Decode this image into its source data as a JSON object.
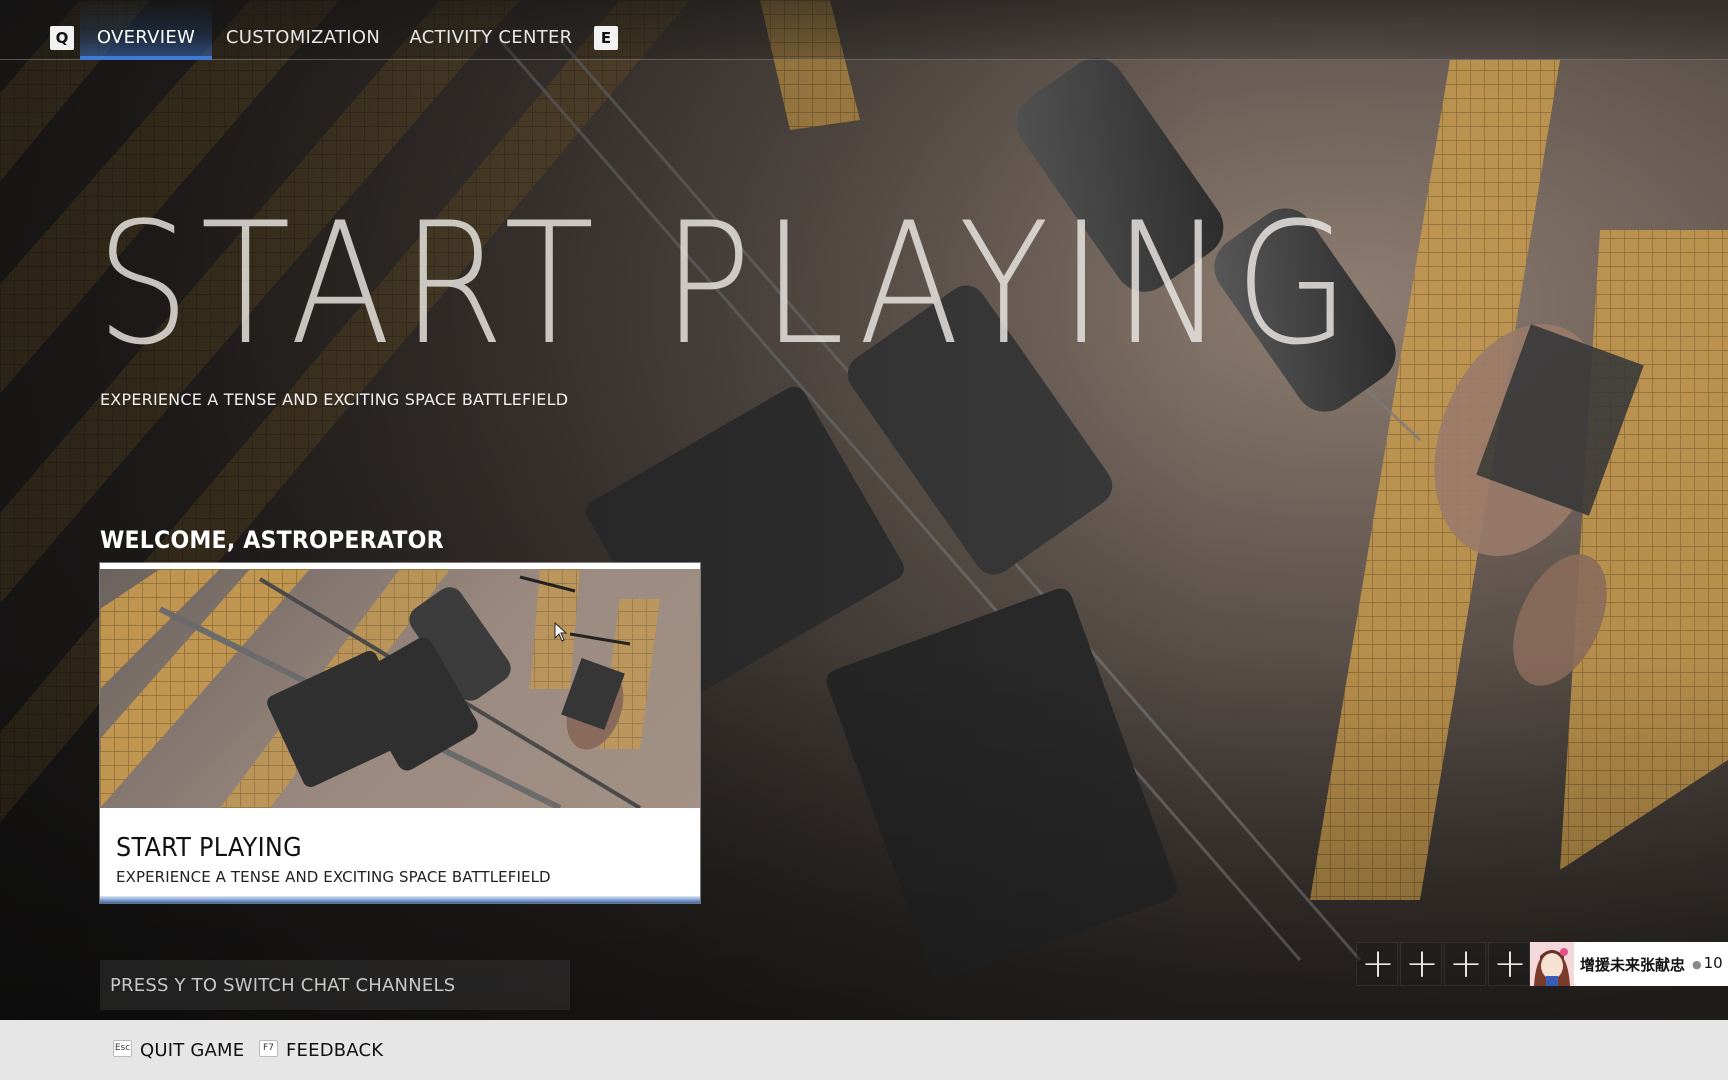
{
  "nav": {
    "prev_key": "Q",
    "next_key": "E",
    "tabs": [
      {
        "label": "OVERVIEW",
        "active": true
      },
      {
        "label": "CUSTOMIZATION",
        "active": false
      },
      {
        "label": "ACTIVITY CENTER",
        "active": false
      }
    ]
  },
  "hero": {
    "title": "START PLAYING",
    "subtitle": "EXPERIENCE A TENSE AND EXCITING SPACE BATTLEFIELD"
  },
  "welcome": {
    "heading": "WELCOME, ASTROPERATOR"
  },
  "card": {
    "title": "START PLAYING",
    "subtitle": "EXPERIENCE A TENSE AND EXCITING SPACE BATTLEFIELD"
  },
  "chat": {
    "placeholder": "PRESS Y TO SWITCH CHAT CHANNELS"
  },
  "party": {
    "empty_slot_icon": "plus-icon",
    "empty_slot_glyph": "+",
    "player_name": "增援未来张献忠",
    "player_level": "10"
  },
  "footer": {
    "quit_key": "Esc",
    "quit_label": "QUIT GAME",
    "feedback_key": "F7",
    "feedback_label": "FEEDBACK"
  },
  "colors": {
    "accent": "#3f7ad6",
    "footer_bg": "#e6e6e6",
    "solar_panel": "#c89a4a"
  }
}
